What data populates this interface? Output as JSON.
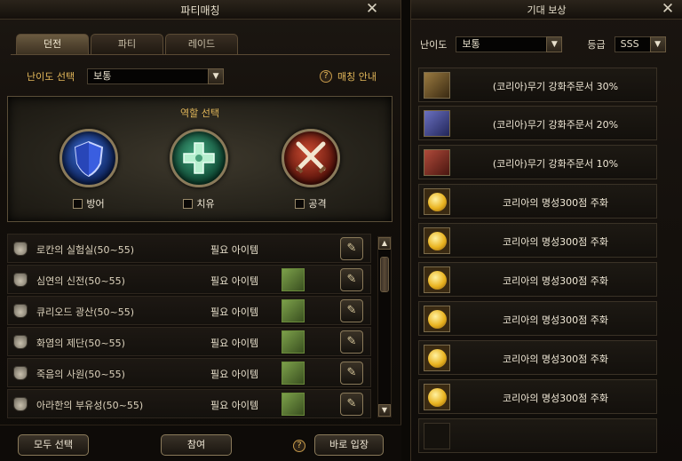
{
  "party_window": {
    "title": "파티매칭",
    "tabs": [
      {
        "label": "던전",
        "active": true
      },
      {
        "label": "파티",
        "active": false
      },
      {
        "label": "레이드",
        "active": false
      }
    ],
    "difficulty_label": "난이도 선택",
    "difficulty_value": "보통",
    "match_guide_label": "매칭 안내",
    "role_title": "역할 선택",
    "roles": [
      {
        "label": "방어",
        "icon": "shield-icon"
      },
      {
        "label": "치유",
        "icon": "heal-cross-icon"
      },
      {
        "label": "공격",
        "icon": "crossed-swords-icon"
      }
    ],
    "dungeons": [
      {
        "name": "로칸의 실험실(50~55)",
        "requirement": "필요 아이템"
      },
      {
        "name": "심연의 신전(50~55)",
        "requirement": "필요 아이템"
      },
      {
        "name": "큐리오드 광산(50~55)",
        "requirement": "필요 아이템"
      },
      {
        "name": "화염의 제단(50~55)",
        "requirement": "필요 아이템"
      },
      {
        "name": "죽음의 사원(50~55)",
        "requirement": "필요 아이템"
      },
      {
        "name": "아라한의 부유성(50~55)",
        "requirement": "필요 아이템"
      }
    ],
    "buttons": {
      "select_all": "모두 선택",
      "join": "참여",
      "enter_now": "바로 입장"
    }
  },
  "reward_window": {
    "title": "기대 보상",
    "difficulty_label": "난이도",
    "difficulty_value": "보통",
    "grade_label": "등급",
    "grade_value": "SSS",
    "rewards": [
      {
        "name": "(코리아)무기 강화주문서 30%",
        "icon": "gold-scroll-icon"
      },
      {
        "name": "(코리아)무기 강화주문서 20%",
        "icon": "blue-scroll-icon"
      },
      {
        "name": "(코리아)무기 강화주문서 10%",
        "icon": "red-scroll-icon"
      },
      {
        "name": "코리아의 명성300점 주화",
        "icon": "gold-coin-icon"
      },
      {
        "name": "코리아의 명성300점 주화",
        "icon": "gold-coin-icon"
      },
      {
        "name": "코리아의 명성300점 주화",
        "icon": "gold-coin-icon"
      },
      {
        "name": "코리아의 명성300점 주화",
        "icon": "gold-coin-icon"
      },
      {
        "name": "코리아의 명성300점 주화",
        "icon": "gold-coin-icon"
      },
      {
        "name": "코리아의 명성300점 주화",
        "icon": "gold-coin-icon"
      }
    ]
  },
  "colors": {
    "accent_gold": "#e3b85a",
    "text_light": "#f0e8d6",
    "panel_bg": "#120e0a"
  }
}
